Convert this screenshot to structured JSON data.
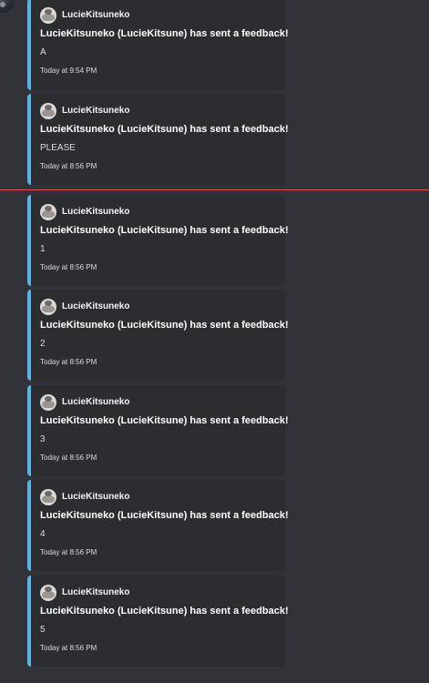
{
  "messages": [
    {
      "author": "LucieKitsuneko",
      "title": "LucieKitsuneko (LucieKitsune) has sent a feedback!",
      "description": "A",
      "timestamp": "Today at 9:54 PM"
    },
    {
      "author": "LucieKitsuneko",
      "title": "LucieKitsuneko (LucieKitsune) has sent a feedback!",
      "description": "PLEASE",
      "timestamp": "Today at 8:56 PM"
    },
    {
      "author": "LucieKitsuneko",
      "title": "LucieKitsuneko (LucieKitsune) has sent a feedback!",
      "description": "1",
      "timestamp": "Today at 8:56 PM"
    },
    {
      "author": "LucieKitsuneko",
      "title": "LucieKitsuneko (LucieKitsune) has sent a feedback!",
      "description": "2",
      "timestamp": "Today at 8:56 PM"
    },
    {
      "author": "LucieKitsuneko",
      "title": "LucieKitsuneko (LucieKitsune) has sent a feedback!",
      "description": "3",
      "timestamp": "Today at 8:56 PM"
    },
    {
      "author": "LucieKitsuneko",
      "title": "LucieKitsuneko (LucieKitsune) has sent a feedback!",
      "description": "4",
      "timestamp": "Today at 8:56 PM"
    },
    {
      "author": "LucieKitsuneko",
      "title": "LucieKitsuneko (LucieKitsune) has sent a feedback!",
      "description": "5",
      "timestamp": "Today at 8:56 PM"
    }
  ],
  "colors": {
    "background": "#313338",
    "embed_background": "#2b2d31",
    "embed_accent": "#5ab3e6",
    "new_messages_divider": "#e2505b"
  }
}
